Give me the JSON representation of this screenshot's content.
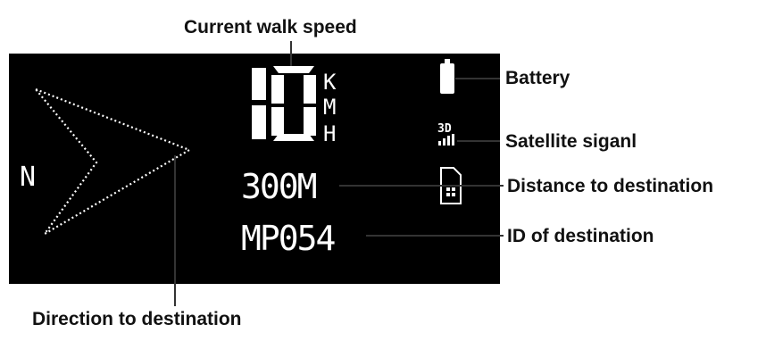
{
  "colors": {
    "screen": "#000000",
    "pixel": "#ffffff",
    "callout_text": "#111111",
    "leader_line": "#333333"
  },
  "screen": {
    "speed_digits": "10",
    "speed_unit_chars": [
      "K",
      "M",
      "H"
    ],
    "gps_fix_label": "3D",
    "north_label": "N",
    "distance": "300M",
    "destination_id": "MP054",
    "icons": [
      "direction-arrow-icon",
      "battery-icon",
      "satellite-signal-icon",
      "sd-card-icon"
    ]
  },
  "callouts": {
    "speed": "Current walk speed",
    "battery": "Battery",
    "satellite": "Satellite siganl",
    "distance": "Distance to destination",
    "id": "ID of destination",
    "direction": "Direction to destination"
  }
}
